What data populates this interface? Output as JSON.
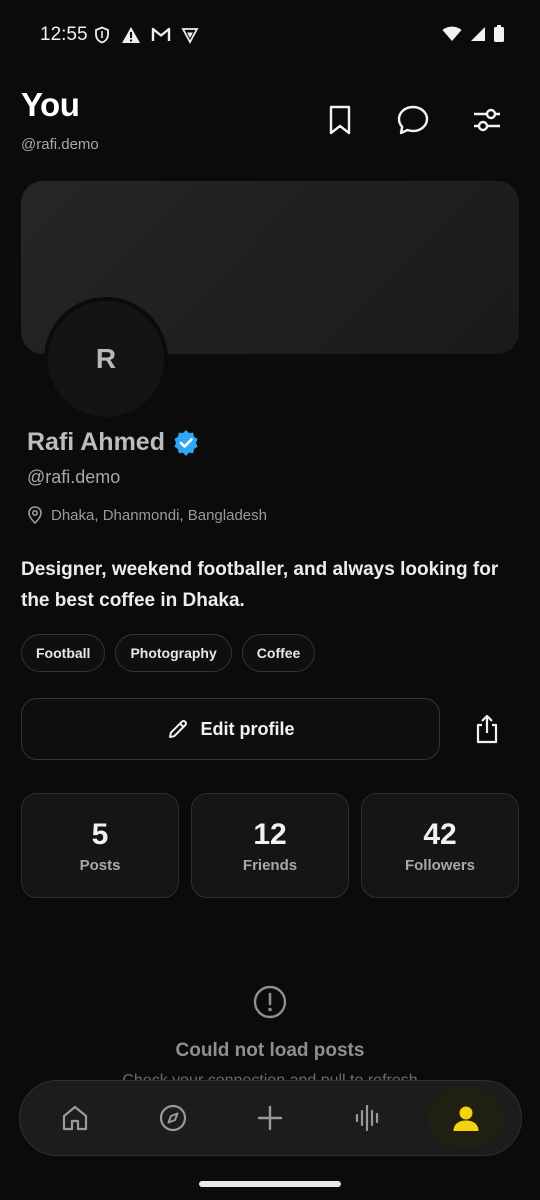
{
  "status_bar": {
    "time": "12:55",
    "icons": [
      "shield-icon",
      "warning-icon",
      "gmail-icon",
      "vpn-icon"
    ],
    "right_icons": [
      "wifi-icon",
      "signal-icon",
      "battery-icon"
    ]
  },
  "header": {
    "title": "You",
    "handle": "@rafi.demo",
    "actions": [
      "bookmark-icon",
      "chat-icon",
      "sliders-icon"
    ]
  },
  "profile": {
    "avatar_initial": "R",
    "display_name": "Rafi Ahmed",
    "verified": true,
    "username": "@rafi.demo",
    "location": "Dhaka, Dhanmondi, Bangladesh",
    "bio": "Designer, weekend footballer, and always looking for the best coffee in Dhaka.",
    "tags": [
      "Football",
      "Photography",
      "Coffee"
    ]
  },
  "actions": {
    "edit_label": "Edit profile",
    "share_icon": "share-icon"
  },
  "stats": [
    {
      "value": "5",
      "label": "Posts"
    },
    {
      "value": "12",
      "label": "Friends"
    },
    {
      "value": "42",
      "label": "Followers"
    }
  ],
  "posts_state": {
    "title": "Could not load posts",
    "subtitle": "Check your connection and pull to refresh"
  },
  "bottom_nav": {
    "items": [
      "home-icon",
      "explore-icon",
      "add-icon",
      "audio-icon",
      "profile-icon"
    ],
    "active": "profile-icon"
  },
  "colors": {
    "accent": "#f5d20b",
    "verified": "#2ea8f5",
    "background": "#0b0b0c"
  }
}
